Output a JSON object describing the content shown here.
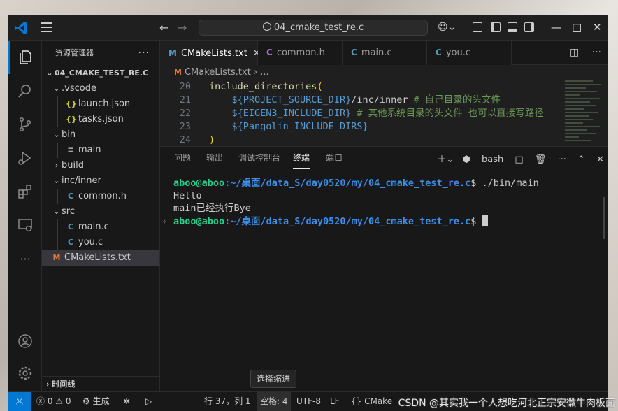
{
  "titlebar": {
    "search_text": "04_cmake_test_re.c"
  },
  "sidebar": {
    "title": "资源管理器",
    "more": "···",
    "root": "04_CMAKE_TEST_RE.C",
    "tree": [
      {
        "label": ".vscode",
        "type": "folder",
        "open": true,
        "depth": 1
      },
      {
        "label": "launch.json",
        "type": "json",
        "depth": 2
      },
      {
        "label": "tasks.json",
        "type": "json",
        "depth": 2
      },
      {
        "label": "bin",
        "type": "folder",
        "open": true,
        "depth": 1
      },
      {
        "label": "main",
        "type": "bin",
        "depth": 2
      },
      {
        "label": "build",
        "type": "folder",
        "open": false,
        "depth": 1
      },
      {
        "label": "inc/inner",
        "type": "folder",
        "open": true,
        "depth": 1
      },
      {
        "label": "common.h",
        "type": "c",
        "depth": 2
      },
      {
        "label": "src",
        "type": "folder",
        "open": true,
        "depth": 1
      },
      {
        "label": "main.c",
        "type": "c",
        "depth": 2
      },
      {
        "label": "you.c",
        "type": "c",
        "depth": 2
      },
      {
        "label": "CMakeLists.txt",
        "type": "m",
        "depth": 1,
        "selected": true
      }
    ],
    "timeline": "时间线"
  },
  "editor": {
    "tabs": [
      {
        "label": "CMakeLists.txt",
        "icon": "M",
        "active": true
      },
      {
        "label": "common.h",
        "icon": "C"
      },
      {
        "label": "main.c",
        "icon": "C"
      },
      {
        "label": "you.c",
        "icon": "C"
      }
    ],
    "breadcrumb": {
      "file": "CMakeLists.txt",
      "rest": "› ..."
    },
    "lines": [
      {
        "num": "20",
        "kw": "include_directories",
        "paren": "("
      },
      {
        "num": "21",
        "var": "${PROJECT_SOURCE_DIR}",
        "rest": "/inc/inner",
        "cmt": "# 自己目录的头文件"
      },
      {
        "num": "22",
        "var": "${EIGEN3_INCLUDE_DIR}",
        "rest": " ",
        "cmt": "# 其他系统目录的头文件 也可以直接写路径"
      },
      {
        "num": "23",
        "var": "${Pangolin_INCLUDE_DIRS}",
        "rest": "",
        "cmt": ""
      },
      {
        "num": "24",
        "paren": ")"
      }
    ]
  },
  "panel": {
    "tabs": [
      "问题",
      "输出",
      "调试控制台",
      "终端",
      "端口"
    ],
    "active_tab": "终端",
    "shell": "bash",
    "terminal": {
      "user": "aboo@aboo",
      "path": ":~/桌面/data_S/day0520/my/04_cmake_test_re.c",
      "command": "$ ./bin/main",
      "output": [
        "Hello",
        "main已经执行Bye"
      ],
      "prompt_end": "$ "
    }
  },
  "statusbar": {
    "errors": "0",
    "warnings": "0",
    "build": "生成",
    "position": "行 37，列 1",
    "indent": "空格: 4",
    "encoding": "UTF-8",
    "eol": "LF",
    "language": "CMake",
    "tooltip": "选择缩进",
    "watermark": "CSDN @其实我一个人想吃河北正宗安徽牛肉板面"
  }
}
